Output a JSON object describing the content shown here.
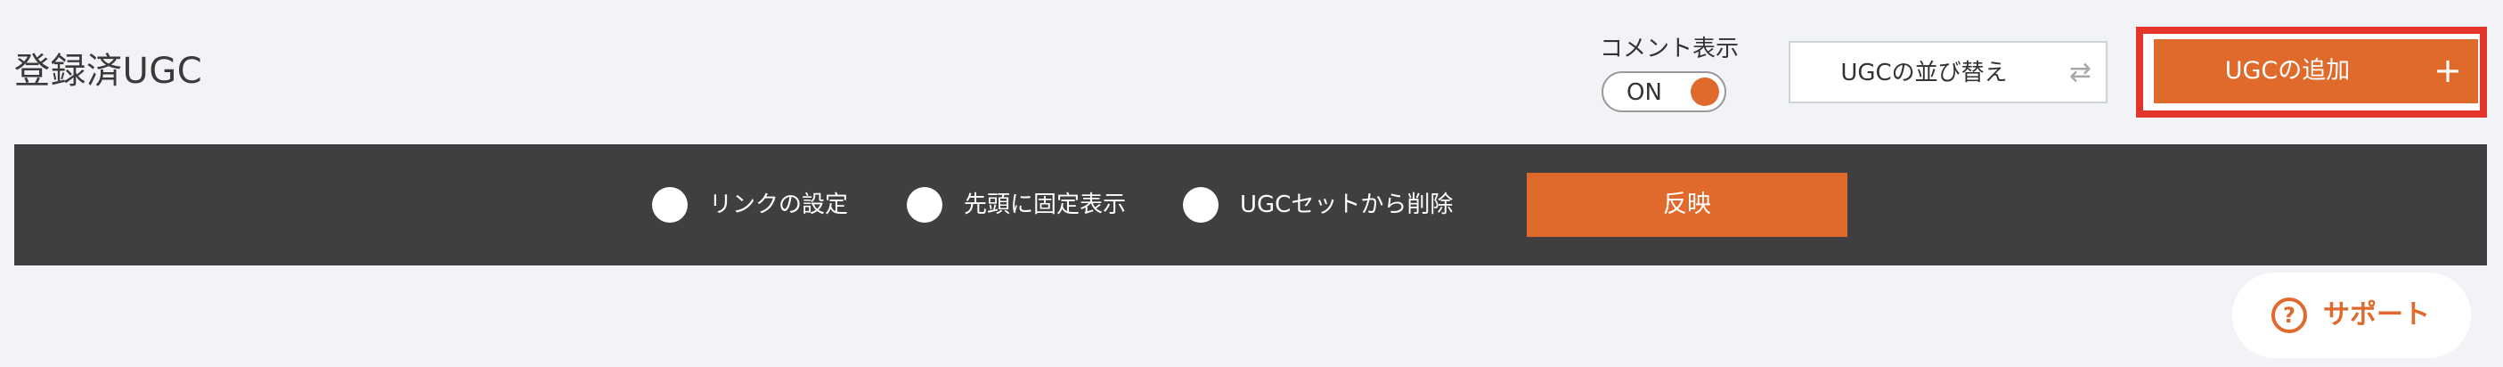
{
  "header": {
    "title": "登録済UGC",
    "comment_toggle": {
      "label": "コメント表示",
      "state": "ON"
    },
    "sort_button": {
      "label": "UGCの並び替え",
      "icon": "swap-arrows-icon",
      "icon_glyph": "⇄"
    },
    "add_button": {
      "label": "UGCの追加",
      "icon": "plus-icon",
      "icon_glyph": "+"
    }
  },
  "action_bar": {
    "options": [
      {
        "label": "リンクの設定",
        "selected": false
      },
      {
        "label": "先頭に固定表示",
        "selected": false
      },
      {
        "label": "UGCセットから削除",
        "selected": false
      }
    ],
    "apply_label": "反映"
  },
  "support": {
    "label": "サポート",
    "icon": "help-circle-icon",
    "icon_glyph": "?"
  },
  "colors": {
    "accent": "#df6a2c",
    "highlight": "#e4352a",
    "bar_background": "#3f3f41",
    "page_background": "#f2f3f7"
  }
}
